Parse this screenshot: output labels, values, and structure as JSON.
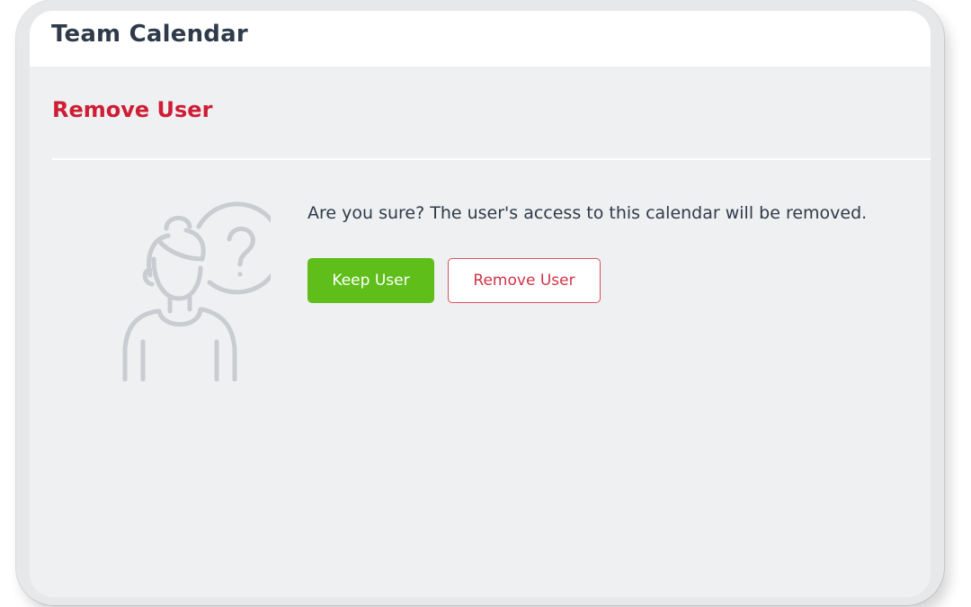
{
  "app": {
    "title": "Team Calendar"
  },
  "dialog": {
    "title": "Remove User",
    "message": "Are you sure? The user's access to this calendar will be removed.",
    "illustration_icon": "person-question-icon",
    "buttons": {
      "keep_label": "Keep User",
      "remove_label": "Remove User"
    }
  },
  "colors": {
    "title_text": "#2f3b4a",
    "danger": "#cf1d35",
    "primary_green": "#5fbe1a",
    "background": "#eef0f1"
  }
}
